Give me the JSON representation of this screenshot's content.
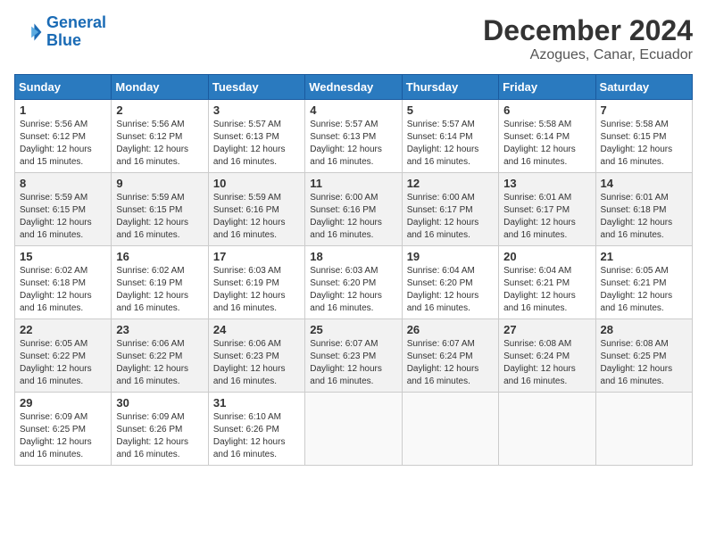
{
  "header": {
    "logo_line1": "General",
    "logo_line2": "Blue",
    "main_title": "December 2024",
    "subtitle": "Azogues, Canar, Ecuador"
  },
  "weekdays": [
    "Sunday",
    "Monday",
    "Tuesday",
    "Wednesday",
    "Thursday",
    "Friday",
    "Saturday"
  ],
  "weeks": [
    [
      {
        "day": "1",
        "info": "Sunrise: 5:56 AM\nSunset: 6:12 PM\nDaylight: 12 hours and 15 minutes."
      },
      {
        "day": "2",
        "info": "Sunrise: 5:56 AM\nSunset: 6:12 PM\nDaylight: 12 hours and 16 minutes."
      },
      {
        "day": "3",
        "info": "Sunrise: 5:57 AM\nSunset: 6:13 PM\nDaylight: 12 hours and 16 minutes."
      },
      {
        "day": "4",
        "info": "Sunrise: 5:57 AM\nSunset: 6:13 PM\nDaylight: 12 hours and 16 minutes."
      },
      {
        "day": "5",
        "info": "Sunrise: 5:57 AM\nSunset: 6:14 PM\nDaylight: 12 hours and 16 minutes."
      },
      {
        "day": "6",
        "info": "Sunrise: 5:58 AM\nSunset: 6:14 PM\nDaylight: 12 hours and 16 minutes."
      },
      {
        "day": "7",
        "info": "Sunrise: 5:58 AM\nSunset: 6:15 PM\nDaylight: 12 hours and 16 minutes."
      }
    ],
    [
      {
        "day": "8",
        "info": "Sunrise: 5:59 AM\nSunset: 6:15 PM\nDaylight: 12 hours and 16 minutes."
      },
      {
        "day": "9",
        "info": "Sunrise: 5:59 AM\nSunset: 6:15 PM\nDaylight: 12 hours and 16 minutes."
      },
      {
        "day": "10",
        "info": "Sunrise: 5:59 AM\nSunset: 6:16 PM\nDaylight: 12 hours and 16 minutes."
      },
      {
        "day": "11",
        "info": "Sunrise: 6:00 AM\nSunset: 6:16 PM\nDaylight: 12 hours and 16 minutes."
      },
      {
        "day": "12",
        "info": "Sunrise: 6:00 AM\nSunset: 6:17 PM\nDaylight: 12 hours and 16 minutes."
      },
      {
        "day": "13",
        "info": "Sunrise: 6:01 AM\nSunset: 6:17 PM\nDaylight: 12 hours and 16 minutes."
      },
      {
        "day": "14",
        "info": "Sunrise: 6:01 AM\nSunset: 6:18 PM\nDaylight: 12 hours and 16 minutes."
      }
    ],
    [
      {
        "day": "15",
        "info": "Sunrise: 6:02 AM\nSunset: 6:18 PM\nDaylight: 12 hours and 16 minutes."
      },
      {
        "day": "16",
        "info": "Sunrise: 6:02 AM\nSunset: 6:19 PM\nDaylight: 12 hours and 16 minutes."
      },
      {
        "day": "17",
        "info": "Sunrise: 6:03 AM\nSunset: 6:19 PM\nDaylight: 12 hours and 16 minutes."
      },
      {
        "day": "18",
        "info": "Sunrise: 6:03 AM\nSunset: 6:20 PM\nDaylight: 12 hours and 16 minutes."
      },
      {
        "day": "19",
        "info": "Sunrise: 6:04 AM\nSunset: 6:20 PM\nDaylight: 12 hours and 16 minutes."
      },
      {
        "day": "20",
        "info": "Sunrise: 6:04 AM\nSunset: 6:21 PM\nDaylight: 12 hours and 16 minutes."
      },
      {
        "day": "21",
        "info": "Sunrise: 6:05 AM\nSunset: 6:21 PM\nDaylight: 12 hours and 16 minutes."
      }
    ],
    [
      {
        "day": "22",
        "info": "Sunrise: 6:05 AM\nSunset: 6:22 PM\nDaylight: 12 hours and 16 minutes."
      },
      {
        "day": "23",
        "info": "Sunrise: 6:06 AM\nSunset: 6:22 PM\nDaylight: 12 hours and 16 minutes."
      },
      {
        "day": "24",
        "info": "Sunrise: 6:06 AM\nSunset: 6:23 PM\nDaylight: 12 hours and 16 minutes."
      },
      {
        "day": "25",
        "info": "Sunrise: 6:07 AM\nSunset: 6:23 PM\nDaylight: 12 hours and 16 minutes."
      },
      {
        "day": "26",
        "info": "Sunrise: 6:07 AM\nSunset: 6:24 PM\nDaylight: 12 hours and 16 minutes."
      },
      {
        "day": "27",
        "info": "Sunrise: 6:08 AM\nSunset: 6:24 PM\nDaylight: 12 hours and 16 minutes."
      },
      {
        "day": "28",
        "info": "Sunrise: 6:08 AM\nSunset: 6:25 PM\nDaylight: 12 hours and 16 minutes."
      }
    ],
    [
      {
        "day": "29",
        "info": "Sunrise: 6:09 AM\nSunset: 6:25 PM\nDaylight: 12 hours and 16 minutes."
      },
      {
        "day": "30",
        "info": "Sunrise: 6:09 AM\nSunset: 6:26 PM\nDaylight: 12 hours and 16 minutes."
      },
      {
        "day": "31",
        "info": "Sunrise: 6:10 AM\nSunset: 6:26 PM\nDaylight: 12 hours and 16 minutes."
      },
      null,
      null,
      null,
      null
    ]
  ]
}
